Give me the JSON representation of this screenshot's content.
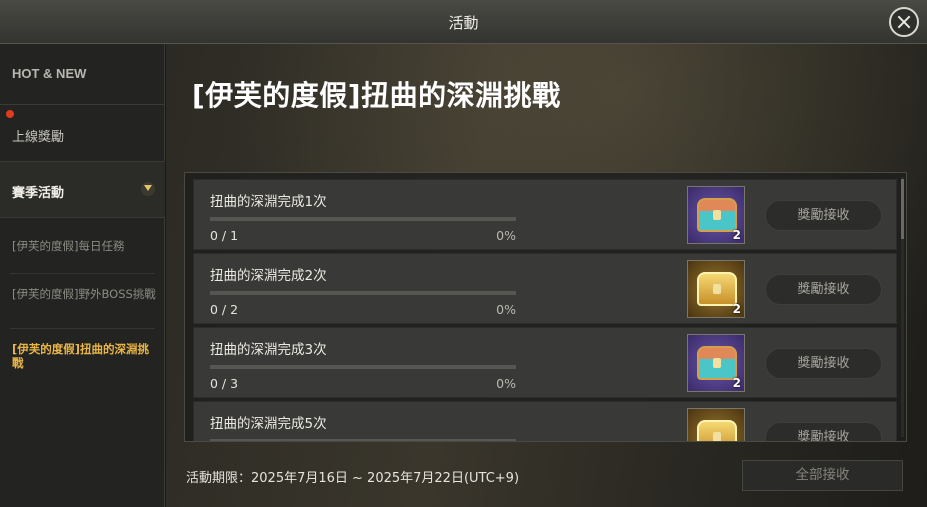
{
  "window": {
    "title": "活動"
  },
  "sidebar": {
    "hot_new": "HOT & NEW",
    "login_reward": "上線獎勵",
    "season_event": "賽季活動",
    "sub_items": [
      "[伊芙的度假]每日任務",
      "[伊芙的度假]野外BOSS挑戰",
      "[伊芙的度假]扭曲的深淵挑戰"
    ]
  },
  "main": {
    "title": "[伊芙的度假]扭曲的深淵挑戰",
    "claim_label": "獎勵接收",
    "missions": [
      {
        "name": "扭曲的深淵完成1次",
        "progress": "0 / 1",
        "percent": "0%",
        "reward_qty": "2",
        "reward_icon": "teal-chest-icon"
      },
      {
        "name": "扭曲的深淵完成2次",
        "progress": "0 / 2",
        "percent": "0%",
        "reward_qty": "2",
        "reward_icon": "gold-chest-icon"
      },
      {
        "name": "扭曲的深淵完成3次",
        "progress": "0 / 3",
        "percent": "0%",
        "reward_qty": "2",
        "reward_icon": "teal-chest-icon"
      },
      {
        "name": "扭曲的深淵完成5次",
        "reward_icon": "gold-chest-icon"
      }
    ],
    "period": "活動期限：2025年7月16日 ~ 2025年7月22日(UTC+9)",
    "claim_all_label": "全部接收"
  },
  "colors": {
    "accent_gold": "#e7b548",
    "notification_red": "#e03a20"
  }
}
